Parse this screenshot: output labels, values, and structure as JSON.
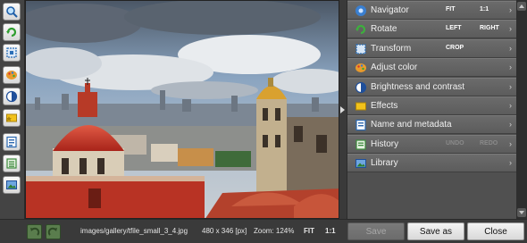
{
  "toolbar": {
    "tools": [
      {
        "icon": "magnifier-icon"
      },
      {
        "icon": "rotate-icon"
      },
      {
        "icon": "transform-icon"
      },
      {
        "icon": "palette-icon"
      },
      {
        "icon": "contrast-icon"
      },
      {
        "icon": "effects-icon"
      },
      {
        "icon": "metadata-icon"
      },
      {
        "icon": "history-icon"
      },
      {
        "icon": "library-icon"
      }
    ]
  },
  "photo": {
    "description_icon": "photo-canvas"
  },
  "panel": {
    "rows": [
      {
        "label": "Navigator",
        "icon": "navigator-icon",
        "options": [
          "FIT",
          "1:1"
        ],
        "options_dim": [
          false,
          false
        ]
      },
      {
        "label": "Rotate",
        "icon": "rotate-icon",
        "options": [
          "LEFT",
          "RIGHT"
        ],
        "options_dim": [
          false,
          false
        ]
      },
      {
        "label": "Transform",
        "icon": "transform-icon",
        "options": [
          "CROP"
        ],
        "options_dim": [
          false
        ]
      },
      {
        "label": "Adjust color",
        "icon": "palette-icon",
        "options": [],
        "options_dim": []
      },
      {
        "label": "Brightness and contrast",
        "icon": "contrast-icon",
        "options": [],
        "options_dim": []
      },
      {
        "label": "Effects",
        "icon": "effects-icon",
        "options": [],
        "options_dim": []
      },
      {
        "label": "Name and metadata",
        "icon": "metadata-icon",
        "options": [],
        "options_dim": []
      },
      {
        "label": "History",
        "icon": "history-icon",
        "options": [
          "UNDO",
          "REDO"
        ],
        "options_dim": [
          true,
          true
        ]
      },
      {
        "label": "Library",
        "icon": "library-icon",
        "options": [],
        "options_dim": []
      }
    ],
    "chevron": "›"
  },
  "bottom": {
    "file_path": "images/gallery/tfile_small_3_4.jpg",
    "dimensions": "480 x 346 [px]",
    "zoom": "Zoom: 124%",
    "fit": "FIT",
    "one_to_one": "1:1",
    "save_label": "Save",
    "save_as_label": "Save as",
    "close_label": "Close"
  },
  "colors": {
    "panel": "#505050",
    "row": "#636363",
    "accent_green": "#5a7d4d"
  }
}
